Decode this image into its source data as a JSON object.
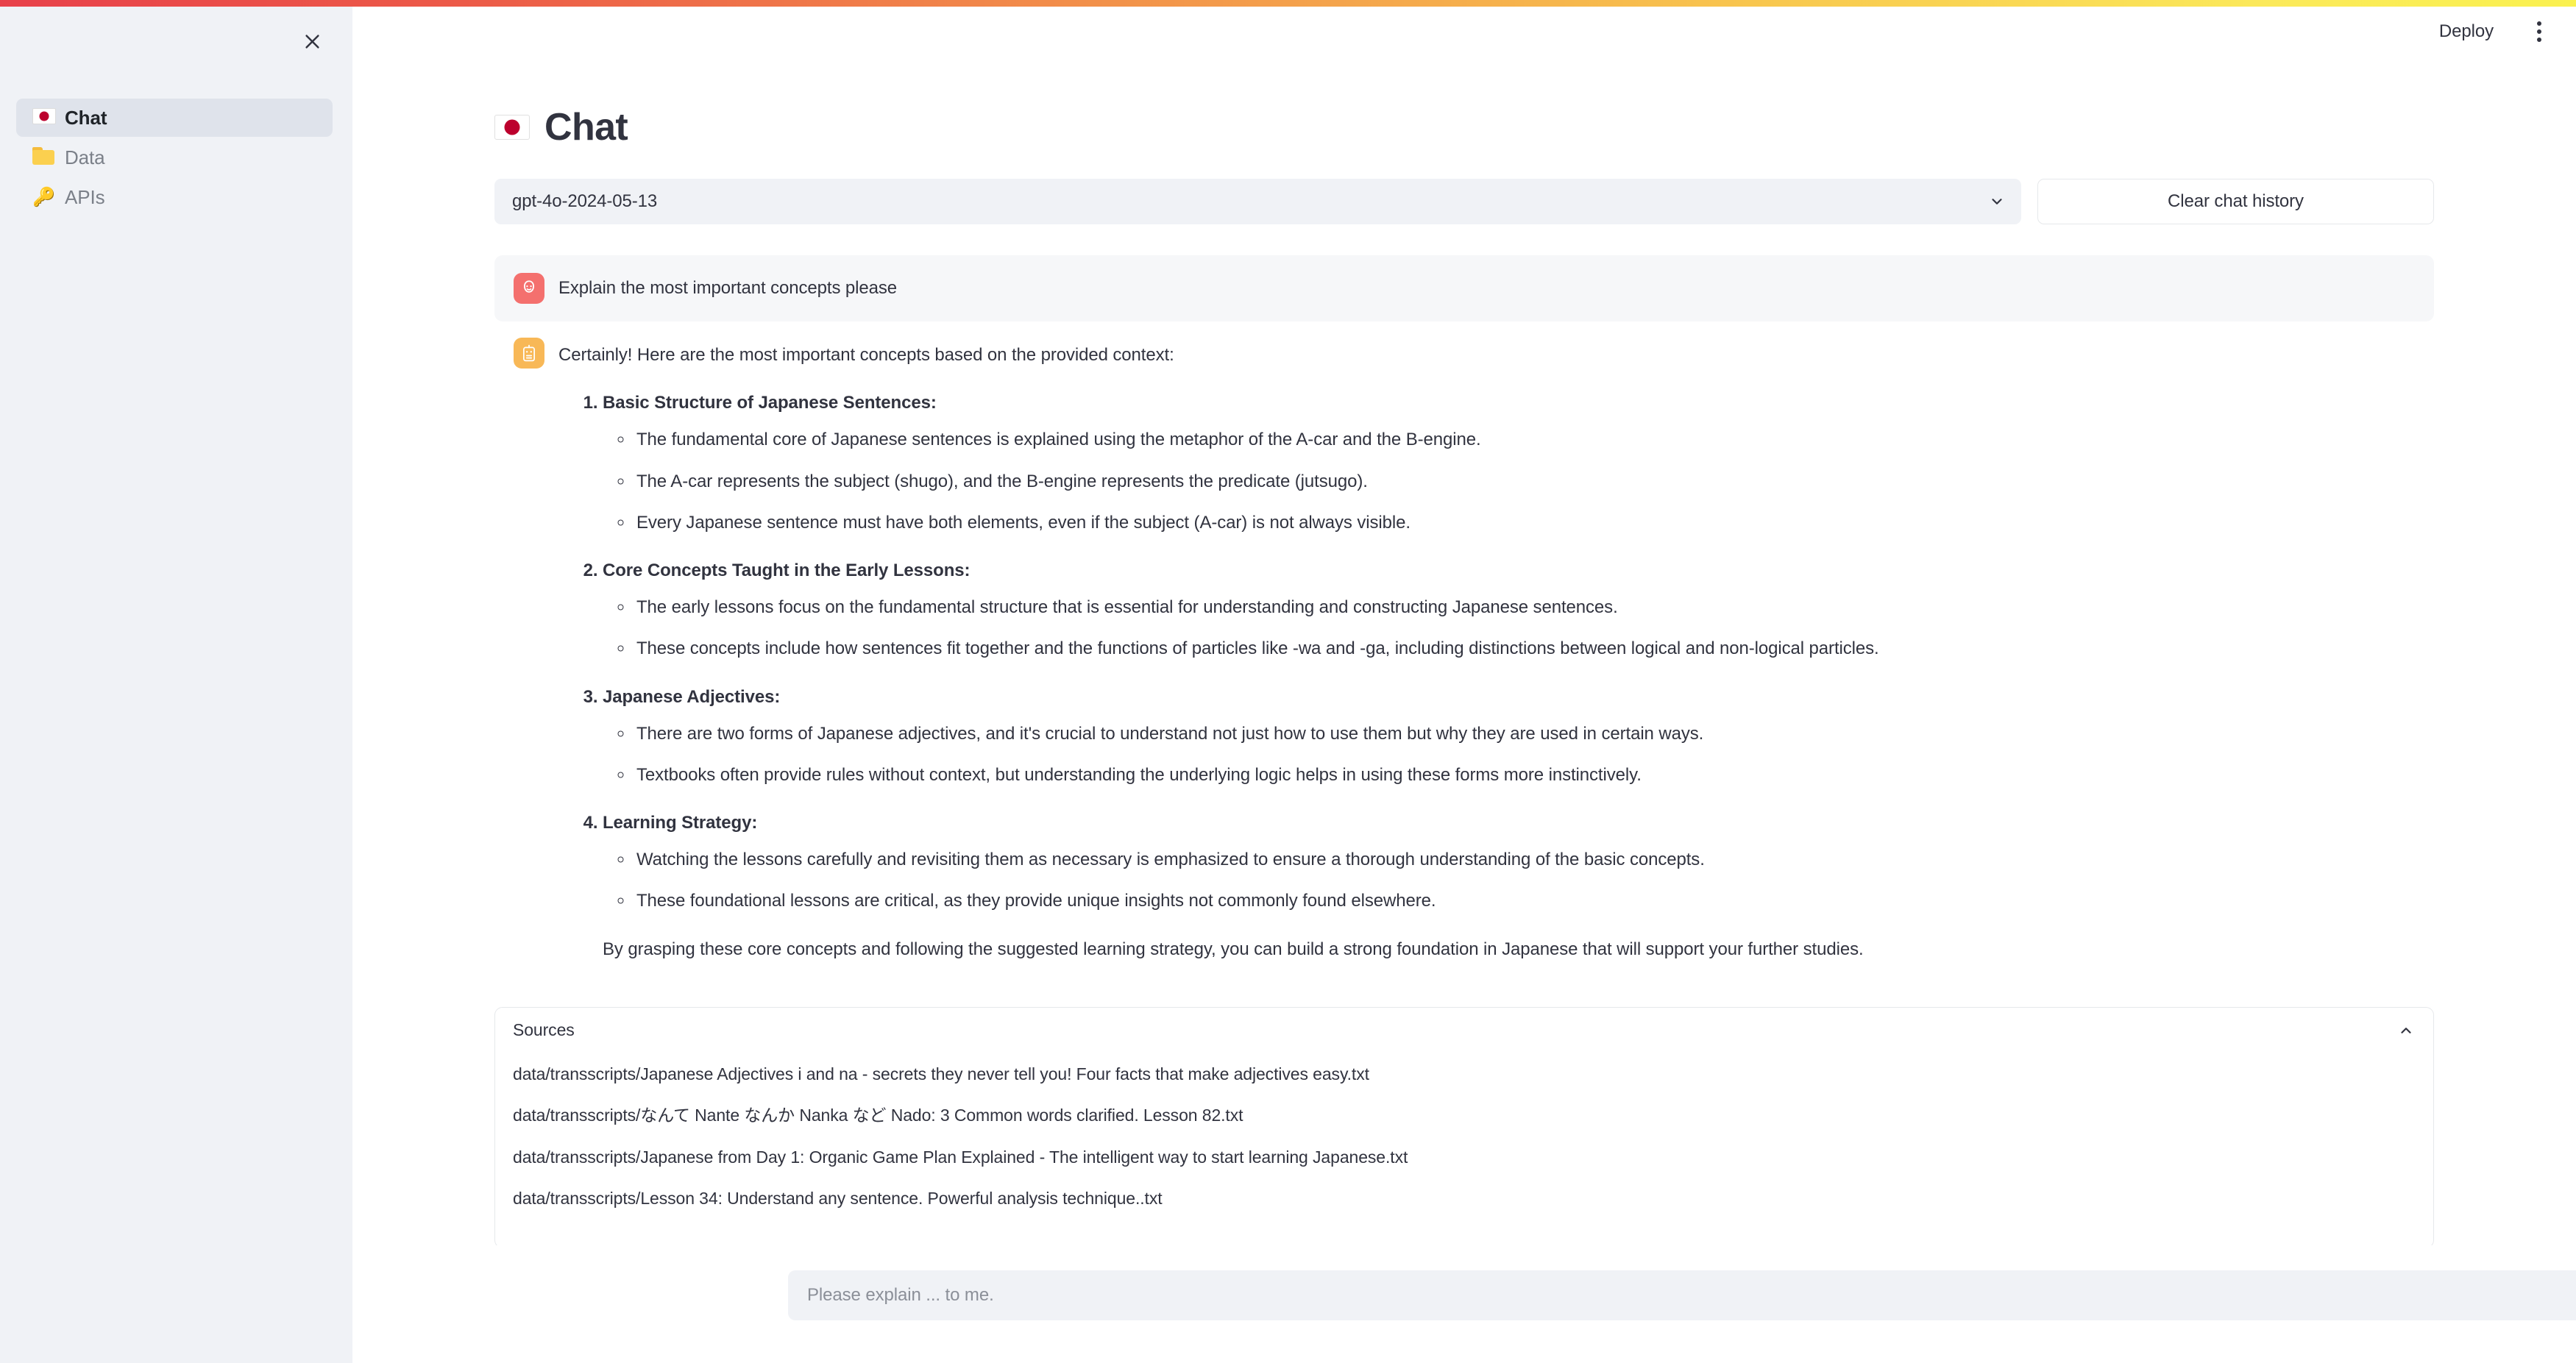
{
  "top_bar": {
    "gradient_start": "#e8414a",
    "gradient_end": "#faf14f"
  },
  "sidebar": {
    "close_icon": "close-icon",
    "items": [
      {
        "icon": "japan-flag-icon",
        "label": "Chat",
        "active": true
      },
      {
        "icon": "folder-icon",
        "label": "Data",
        "active": false
      },
      {
        "icon": "key-icon",
        "label": "APIs",
        "active": false
      }
    ]
  },
  "topbar": {
    "deploy_label": "Deploy",
    "menu_icon": "kebab-menu-icon"
  },
  "header": {
    "flag_icon": "japan-flag-icon",
    "title": "Chat"
  },
  "controls": {
    "model_value": "gpt-4o-2024-05-13",
    "model_chevron": "chevron-down-icon",
    "clear_label": "Clear chat history"
  },
  "messages": [
    {
      "role": "user",
      "avatar": "user-face-icon",
      "avatar_color": "#f4706e",
      "text": "Explain the most important concepts please"
    },
    {
      "role": "assistant",
      "avatar": "robot-icon",
      "avatar_color": "#f8b857",
      "intro": "Certainly! Here are the most important concepts based on the provided context:",
      "sections": [
        {
          "heading": "Basic Structure of Japanese Sentences",
          "bullets": [
            "The fundamental core of Japanese sentences is explained using the metaphor of the A-car and the B-engine.",
            "The A-car represents the subject (shugo), and the B-engine represents the predicate (jutsugo).",
            "Every Japanese sentence must have both elements, even if the subject (A-car) is not always visible."
          ]
        },
        {
          "heading": "Core Concepts Taught in the Early Lessons",
          "bullets": [
            "The early lessons focus on the fundamental structure that is essential for understanding and constructing Japanese sentences.",
            "These concepts include how sentences fit together and the functions of particles like -wa and -ga, including distinctions between logical and non-logical particles."
          ]
        },
        {
          "heading": "Japanese Adjectives",
          "bullets": [
            "There are two forms of Japanese adjectives, and it's crucial to understand not just how to use them but why they are used in certain ways.",
            "Textbooks often provide rules without context, but understanding the underlying logic helps in using these forms more instinctively."
          ]
        },
        {
          "heading": "Learning Strategy",
          "bullets": [
            "Watching the lessons carefully and revisiting them as necessary is emphasized to ensure a thorough understanding of the basic concepts.",
            "These foundational lessons are critical, as they provide unique insights not commonly found elsewhere."
          ]
        }
      ],
      "closing": "By grasping these core concepts and following the suggested learning strategy, you can build a strong foundation in Japanese that will support your further studies."
    }
  ],
  "sources": {
    "label": "Sources",
    "toggle_icon": "chevron-up-icon",
    "expanded": true,
    "items": [
      "data/transscripts/Japanese Adjectives i and na - secrets they never tell you! Four facts that make adjectives easy.txt",
      "data/transscripts/なんて Nante なんか Nanka など Nado: 3 Common words clarified. Lesson 82.txt",
      "data/transscripts/Japanese from Day 1: Organic Game Plan Explained - The intelligent way to start learning Japanese.txt",
      "data/transscripts/Lesson 34: Understand any sentence. Powerful analysis technique..txt"
    ]
  },
  "composer": {
    "placeholder": "Please explain ... to me.",
    "value": "",
    "status_icon": "plug-connected-icon",
    "status_color": "#1c9bf0"
  }
}
